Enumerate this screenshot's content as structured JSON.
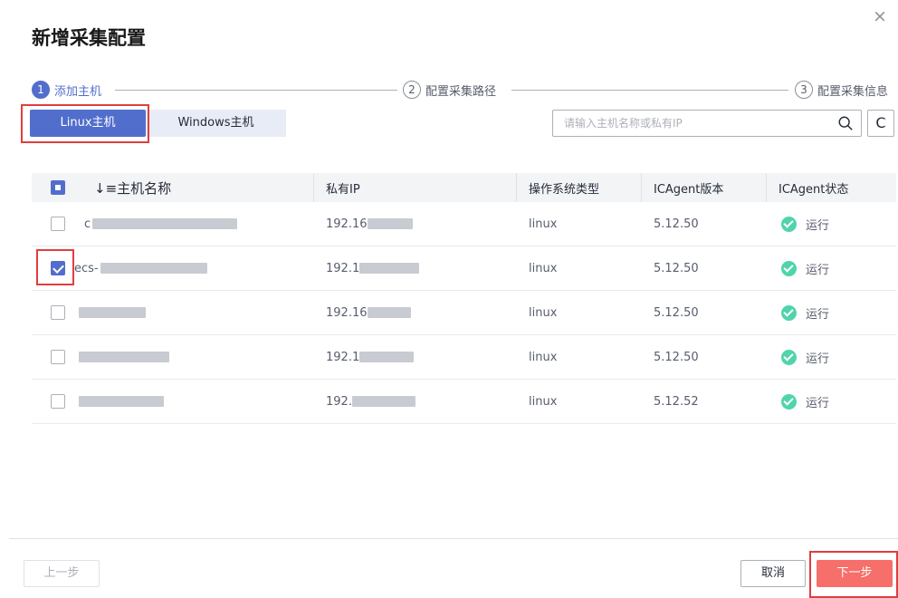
{
  "dialog": {
    "title": "新增采集配置",
    "close_glyph": "×"
  },
  "steps": [
    {
      "num": "1",
      "label": "添加主机",
      "active": true
    },
    {
      "num": "2",
      "label": "配置采集路径",
      "active": false
    },
    {
      "num": "3",
      "label": "配置采集信息",
      "active": false
    }
  ],
  "tabs": [
    {
      "label": "Linux主机",
      "active": true
    },
    {
      "label": "Windows主机",
      "active": false
    }
  ],
  "search": {
    "placeholder": "请输入主机名称或私有IP",
    "value": "",
    "refresh_glyph": "C"
  },
  "table": {
    "headers": [
      "↓≡主机名称",
      "私有IP",
      "操作系统类型",
      "ICAgent版本",
      "ICAgent状态"
    ],
    "rows": [
      {
        "name": "c",
        "ip": "192.16",
        "os": "linux",
        "version": "5.12.50",
        "status": "运行",
        "checked": false
      },
      {
        "name": "ecs-",
        "ip": "192.1",
        "os": "linux",
        "version": "5.12.50",
        "status": "运行",
        "checked": true
      },
      {
        "name": "",
        "ip": "192.16",
        "os": "linux",
        "version": "5.12.50",
        "status": "运行",
        "checked": false
      },
      {
        "name": "",
        "ip": "192.1",
        "os": "linux",
        "version": "5.12.50",
        "status": "运行",
        "checked": false
      },
      {
        "name": "",
        "ip": "192.",
        "os": "linux",
        "version": "5.12.52",
        "status": "运行",
        "checked": false
      }
    ]
  },
  "footer": {
    "prev_label": "上一步",
    "cancel_label": "取消",
    "next_label": "下一步"
  },
  "colors": {
    "primary": "#526ecc",
    "danger_button": "#f66f6a",
    "status_running": "#50d4ab",
    "highlight_box": "#e03e3e"
  }
}
